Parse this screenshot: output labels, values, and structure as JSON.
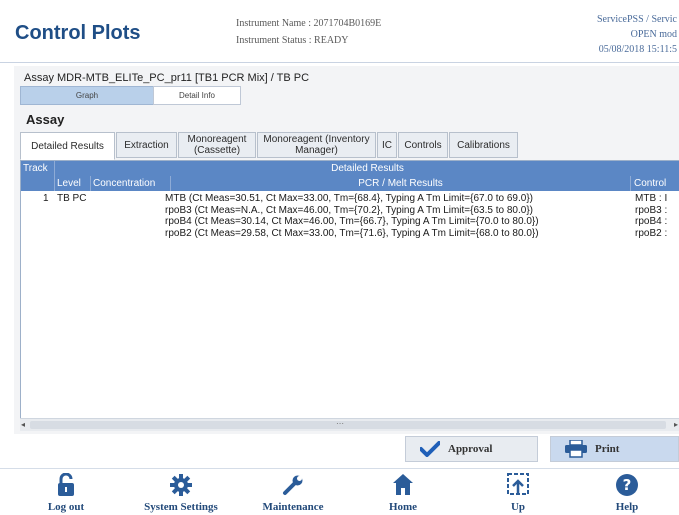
{
  "header": {
    "title": "Control Plots",
    "instrument_name_label": "Instrument Name : 2071704B0169E",
    "instrument_status_label": "Instrument Status : READY",
    "user": "ServicePSS / Servic",
    "mode": "OPEN mod",
    "datetime": "05/08/2018 15:11:5"
  },
  "assay_line": "Assay  MDR-MTB_ELITe_PC_pr11 [TB1 PCR Mix] / TB PC",
  "view_tabs": {
    "graph": "Graph",
    "detail": "Detail Info"
  },
  "section_title": "Assay",
  "tabs": [
    {
      "label": "Detailed Results"
    },
    {
      "label": "Extraction"
    },
    {
      "label": "Monoreagent (Cassette)"
    },
    {
      "label": "Monoreagent (Inventory Manager)"
    },
    {
      "label": "IC"
    },
    {
      "label": "Controls"
    },
    {
      "label": "Calibrations"
    }
  ],
  "grid": {
    "top_headers": {
      "track": "Track",
      "detailed": "Detailed Results"
    },
    "columns": {
      "level": "Level",
      "concentration": "Concentration",
      "pcr": "PCR / Melt Results",
      "control": "Control"
    },
    "row": {
      "track": "1",
      "level": "TB PC",
      "pcr_lines": [
        "MTB (Ct Meas=30.51, Ct Max=33.00, Tm={68.4}, Typing A Tm Limit={67.0 to 69.0})",
        "rpoB3 (Ct Meas=N.A., Ct Max=46.00, Tm={70.2}, Typing A Tm Limit={63.5 to 80.0})",
        "rpoB4 (Ct Meas=30.14, Ct Max=46.00, Tm={66.7}, Typing A Tm Limit={70.0 to 80.0})",
        "rpoB2 (Ct Meas=29.58, Ct Max=33.00, Tm={71.6}, Typing A Tm Limit={68.0 to 80.0})"
      ],
      "control_lines": [
        "MTB : I",
        "rpoB3 :",
        "rpoB4 :",
        "rpoB2 :"
      ]
    }
  },
  "buttons": {
    "approval": "Approval",
    "print": "Print"
  },
  "footer": {
    "logout": "Log out",
    "settings": "System Settings",
    "maintenance": "Maintenance",
    "home": "Home",
    "up": "Up",
    "help": "Help"
  },
  "colors": {
    "accent": "#1f4e86",
    "grid_header": "#5b87c5",
    "approval_check": "#1f5fb8"
  }
}
